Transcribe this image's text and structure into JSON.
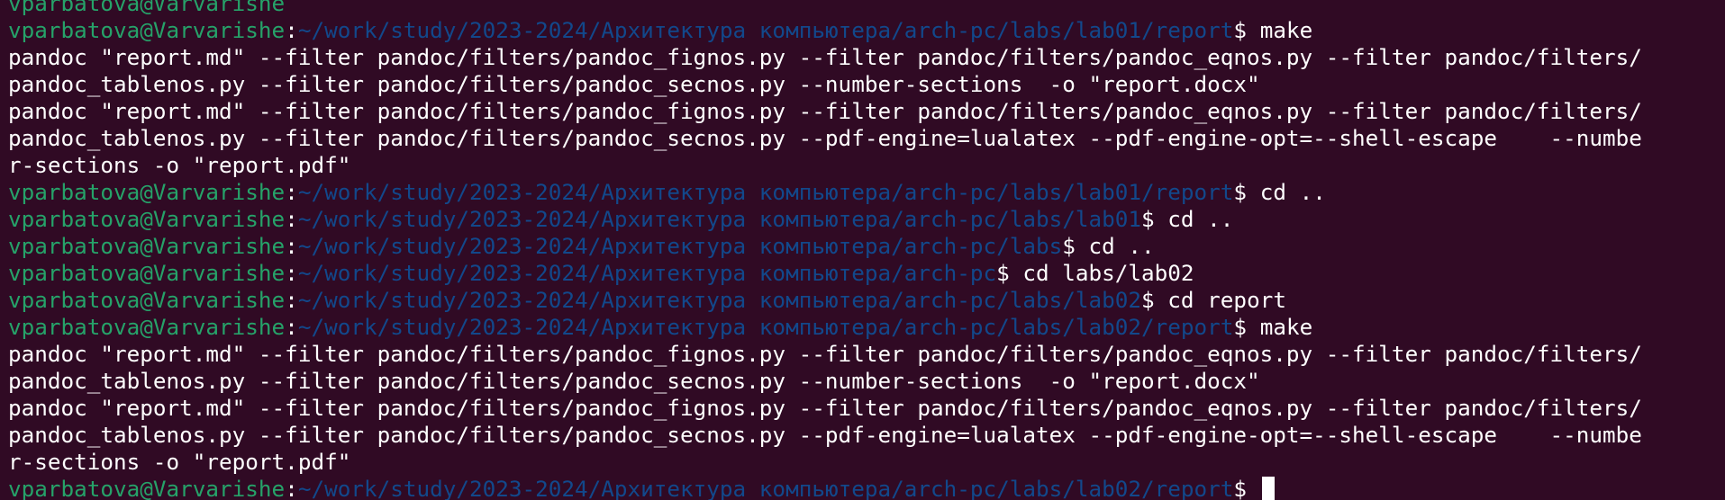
{
  "terminal": {
    "colors": {
      "background": "#300a24",
      "user": "#26a269",
      "path": "#12488b",
      "text": "#ffffff"
    },
    "top_partial": "vparbatova@Varvarishe",
    "lines": [
      {
        "type": "prompt",
        "user": "vparbatova@Varvarishe",
        "path": "~/work/study/2023-2024/Архитектура компьютера/arch-pc/labs/lab01/report",
        "command": "make"
      },
      {
        "type": "output",
        "text": "pandoc \"report.md\" --filter pandoc/filters/pandoc_fignos.py --filter pandoc/filters/pandoc_eqnos.py --filter pandoc/filters/"
      },
      {
        "type": "output",
        "text": "pandoc_tablenos.py --filter pandoc/filters/pandoc_secnos.py --number-sections  -o \"report.docx\""
      },
      {
        "type": "output",
        "text": "pandoc \"report.md\" --filter pandoc/filters/pandoc_fignos.py --filter pandoc/filters/pandoc_eqnos.py --filter pandoc/filters/"
      },
      {
        "type": "output",
        "text": "pandoc_tablenos.py --filter pandoc/filters/pandoc_secnos.py --pdf-engine=lualatex --pdf-engine-opt=--shell-escape    --numbe"
      },
      {
        "type": "output",
        "text": "r-sections -o \"report.pdf\""
      },
      {
        "type": "prompt",
        "user": "vparbatova@Varvarishe",
        "path": "~/work/study/2023-2024/Архитектура компьютера/arch-pc/labs/lab01/report",
        "command": "cd .."
      },
      {
        "type": "prompt",
        "user": "vparbatova@Varvarishe",
        "path": "~/work/study/2023-2024/Архитектура компьютера/arch-pc/labs/lab01",
        "command": "cd .."
      },
      {
        "type": "prompt",
        "user": "vparbatova@Varvarishe",
        "path": "~/work/study/2023-2024/Архитектура компьютера/arch-pc/labs",
        "command": "cd .."
      },
      {
        "type": "prompt",
        "user": "vparbatova@Varvarishe",
        "path": "~/work/study/2023-2024/Архитектура компьютера/arch-pc",
        "command": "cd labs/lab02"
      },
      {
        "type": "prompt",
        "user": "vparbatova@Varvarishe",
        "path": "~/work/study/2023-2024/Архитектура компьютера/arch-pc/labs/lab02",
        "command": "cd report"
      },
      {
        "type": "prompt",
        "user": "vparbatova@Varvarishe",
        "path": "~/work/study/2023-2024/Архитектура компьютера/arch-pc/labs/lab02/report",
        "command": "make"
      },
      {
        "type": "output",
        "text": "pandoc \"report.md\" --filter pandoc/filters/pandoc_fignos.py --filter pandoc/filters/pandoc_eqnos.py --filter pandoc/filters/"
      },
      {
        "type": "output",
        "text": "pandoc_tablenos.py --filter pandoc/filters/pandoc_secnos.py --number-sections  -o \"report.docx\""
      },
      {
        "type": "output",
        "text": "pandoc \"report.md\" --filter pandoc/filters/pandoc_fignos.py --filter pandoc/filters/pandoc_eqnos.py --filter pandoc/filters/"
      },
      {
        "type": "output",
        "text": "pandoc_tablenos.py --filter pandoc/filters/pandoc_secnos.py --pdf-engine=lualatex --pdf-engine-opt=--shell-escape    --numbe"
      },
      {
        "type": "output",
        "text": "r-sections -o \"report.pdf\""
      },
      {
        "type": "prompt",
        "user": "vparbatova@Varvarishe",
        "path": "~/work/study/2023-2024/Архитектура компьютера/arch-pc/labs/lab02/report",
        "command": "",
        "cursor": true
      }
    ]
  }
}
